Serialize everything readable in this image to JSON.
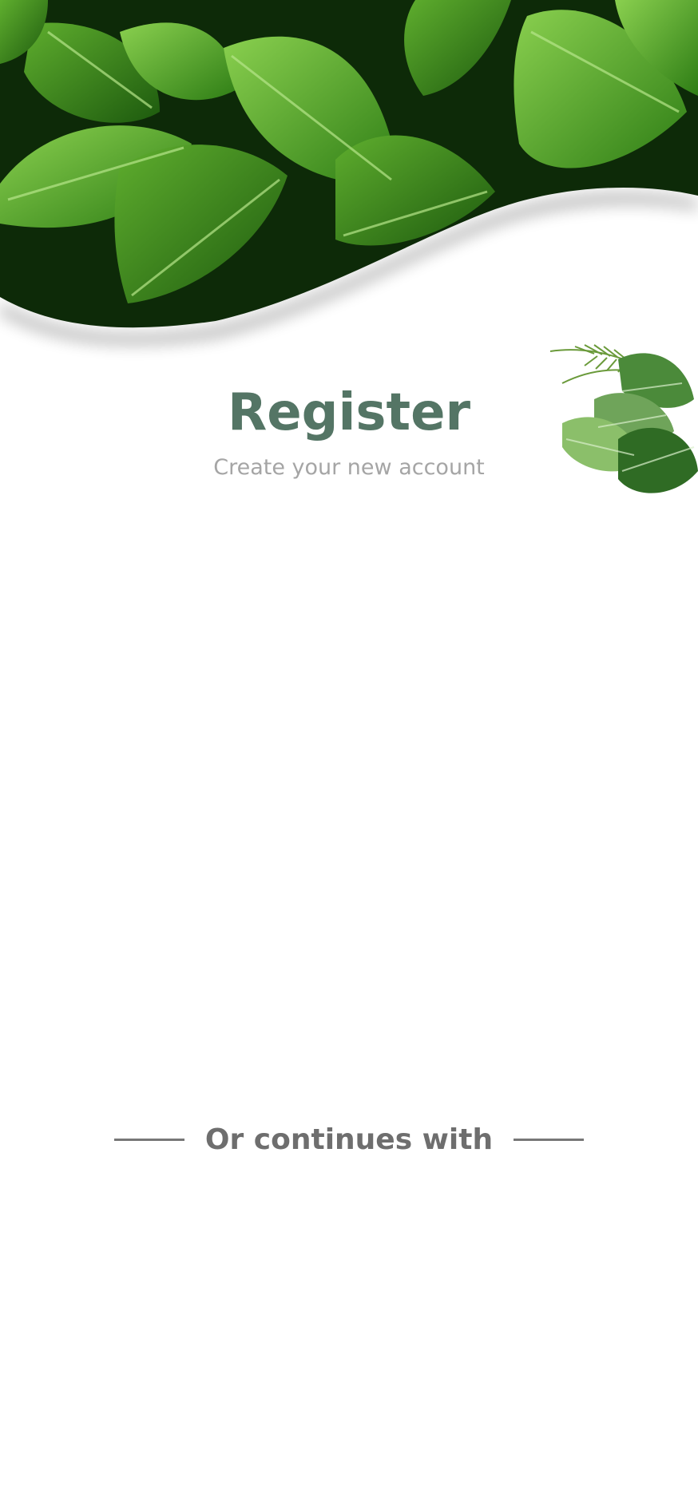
{
  "header": {
    "image": "green-leaves-photo",
    "decoration": "tropical-leaves-icon"
  },
  "register": {
    "title": "Register",
    "subtitle": "Create your new account"
  },
  "social": {
    "divider_label": "Or continues with"
  },
  "colors": {
    "title": "#547565",
    "subtitle": "#a5a5a5",
    "divider_text": "#6e6e6e",
    "divider_line": "#777777",
    "leaf_dark": "#1f5c12",
    "leaf_mid": "#3f8f1f",
    "leaf_light": "#79c145",
    "background": "#ffffff"
  }
}
